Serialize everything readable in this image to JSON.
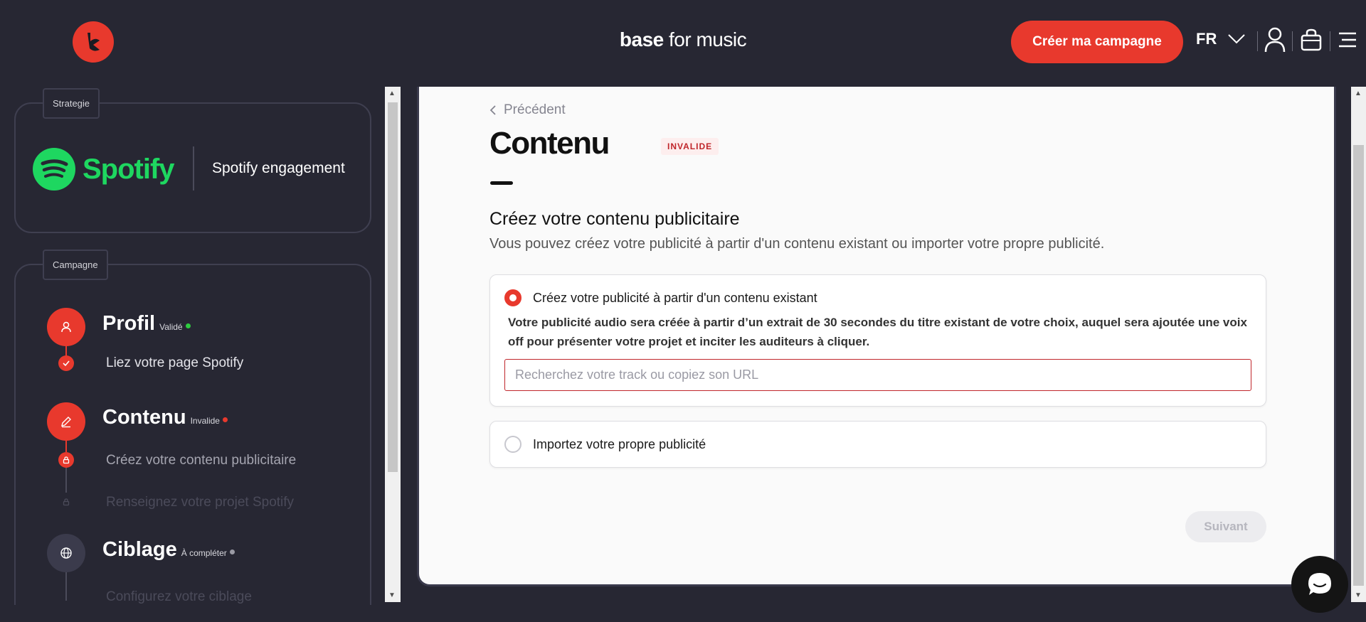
{
  "header": {
    "brand_bold": "base",
    "brand_rest": " for music",
    "cta": "Créer ma campagne",
    "lang": "FR"
  },
  "sidebar": {
    "strategy_tag": "Strategie",
    "spotify_word": "Spotify",
    "strategy_name": "Spotify engagement",
    "campaign_tag": "Campagne",
    "steps": [
      {
        "title": "Profil",
        "status": "Validé",
        "status_color": "#2ecc40"
      },
      {
        "title": "Contenu",
        "status": "Invalide",
        "status_color": "#e8392d"
      },
      {
        "title": "Ciblage",
        "status": "À compléter",
        "status_color": "#9a9aa4"
      }
    ],
    "substeps": {
      "link_spotify": "Liez votre page Spotify",
      "create_content": "Créez votre contenu publicitaire",
      "project_info": "Renseignez votre projet Spotify",
      "targeting": "Configurez votre ciblage"
    }
  },
  "main": {
    "back": "Précédent",
    "title": "Contenu",
    "badge": "INVALIDE",
    "section_title": "Créez votre contenu publicitaire",
    "section_desc": "Vous pouvez créez votre publicité à partir d'un contenu existant ou importer votre propre publicité.",
    "option1_label": "Créez votre publicité à partir d'un contenu existant",
    "option1_desc": "Votre publicité audio sera créée à partir d’un extrait de 30 secondes du titre existant de votre choix, auquel sera ajoutée une voix off pour présenter votre projet et inciter les auditeurs à cliquer.",
    "search_placeholder": "Recherchez votre track ou copiez son URL",
    "search_value": "",
    "option2_label": "Importez votre propre publicité",
    "next": "Suivant"
  },
  "colors": {
    "accent": "#e8392d",
    "background": "#272733",
    "spotify": "#1ed760"
  }
}
